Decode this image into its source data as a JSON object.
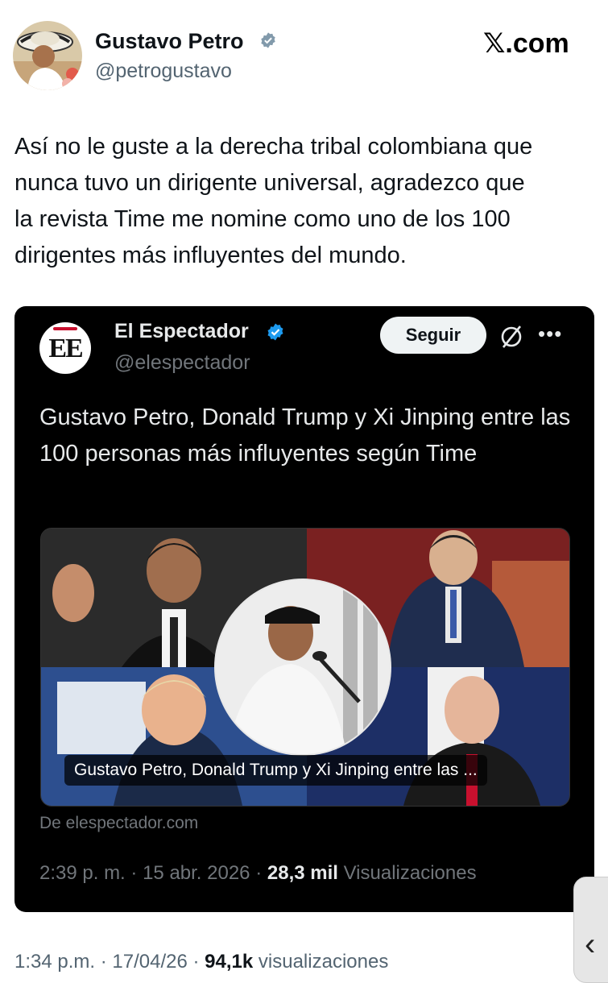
{
  "author": {
    "name": "Gustavo Petro",
    "handle": "@petrogustavo",
    "verified": true
  },
  "site": "𝕏.com",
  "tweet_text": "Así no le guste a la derecha tribal colombiana que\nnunca tuvo un dirigente universal,  agradezco que\nla revista Time me nomine como uno de los 100\ndirigentes más influyentes del mundo.",
  "quoted": {
    "logo_text": "EE",
    "name": "El Espectador",
    "handle": "@elespectador",
    "verified": true,
    "follow_label": "Seguir",
    "text": "Gustavo Petro, Donald Trump y Xi Jinping entre las 100 personas más influyentes según Time",
    "media_caption": "Gustavo Petro, Donald Trump y Xi Jinping entre las ...",
    "source": "De elespectador.com",
    "time": "2:39 p. m.",
    "sep": "·",
    "date": "15 abr. 2026",
    "views_count": "28,3 mil",
    "views_label": "Visualizaciones"
  },
  "footer": {
    "time": "1:34 p.m.",
    "date": "17/04/26",
    "views_count": "94,1k",
    "views_label": "visualizaciones"
  },
  "colors": {
    "accent_verified": "#1d9bf0",
    "card_bg": "#000000"
  }
}
